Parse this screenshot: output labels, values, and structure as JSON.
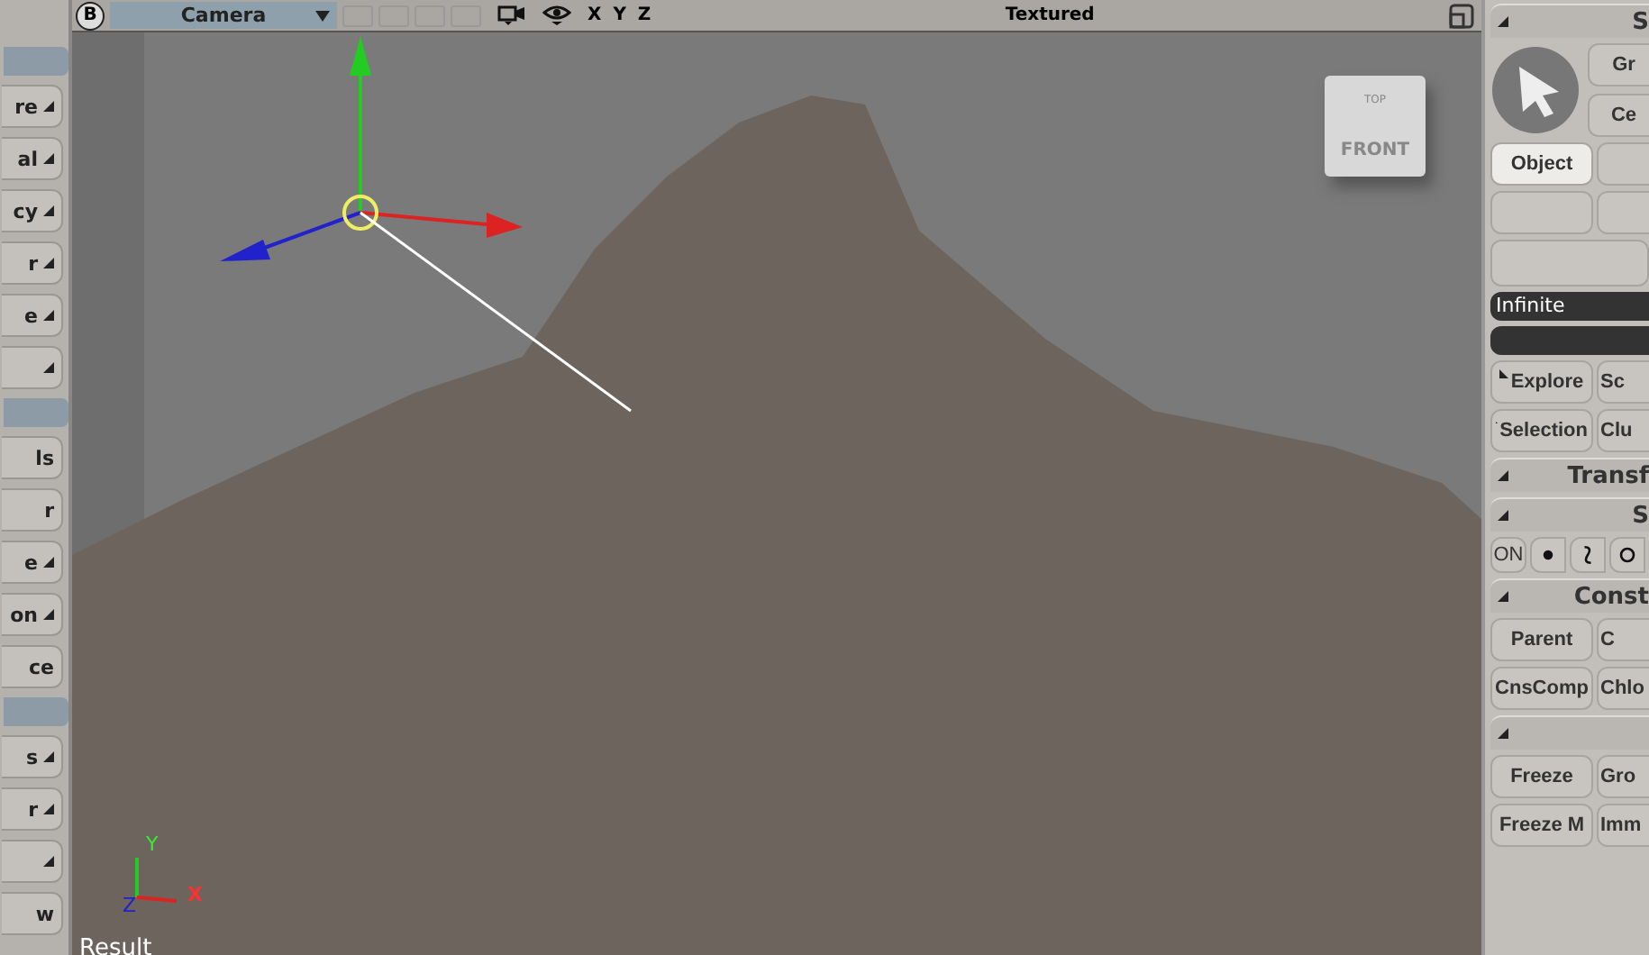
{
  "left_panel": {
    "groups": [
      {
        "items": [
          {
            "label": "re",
            "menu": true
          },
          {
            "label": "al",
            "menu": true
          },
          {
            "label": "cy",
            "menu": true
          },
          {
            "label": "r",
            "menu": true
          },
          {
            "label": "e",
            "menu": true
          },
          {
            "menu": true
          }
        ]
      },
      {
        "items": [
          {
            "label": "ls",
            "menu": false
          },
          {
            "label": "r",
            "menu": false
          },
          {
            "label": "e",
            "menu": true
          },
          {
            "label": "on",
            "menu": true
          },
          {
            "label": "ce",
            "menu": false
          }
        ]
      },
      {
        "items": [
          {
            "label": "s",
            "menu": true
          },
          {
            "label": "r",
            "menu": true
          },
          {
            "menu": true
          },
          {
            "label": "w",
            "menu": false
          }
        ]
      }
    ]
  },
  "viewport": {
    "badge": "B",
    "camera": "Camera",
    "axes": "X Y Z",
    "shading": "Textured",
    "cube_front": "FRONT",
    "cube_top": "TOP",
    "axis_x": "X",
    "axis_y": "Y",
    "axis_z": "Z",
    "caption": "Result"
  },
  "right_panel": {
    "title": "S",
    "tool_buttons": [
      {
        "label": "Gr"
      },
      {
        "label": "Ce"
      }
    ],
    "mode_buttons": [
      {
        "label": "Object",
        "selected": true
      },
      {
        "selected": false
      }
    ],
    "field": "Infinite",
    "rows": [
      [
        {
          "label": "Explore",
          "menu": true
        },
        {
          "label": "Sc",
          "menu": false
        }
      ],
      [
        {
          "label": "Selection",
          "menu": true
        },
        {
          "label": "Clu",
          "menu": false
        }
      ]
    ],
    "transform": "Transf",
    "snap": "S",
    "snap_on": "ON",
    "constrain": "Const",
    "constrain_rows": [
      [
        "Parent",
        "C"
      ],
      [
        "CnsComp",
        "Chlo"
      ]
    ],
    "edit_rows": [
      [
        "Freeze",
        "Gro"
      ],
      [
        "Freeze M",
        "Imm"
      ]
    ]
  }
}
